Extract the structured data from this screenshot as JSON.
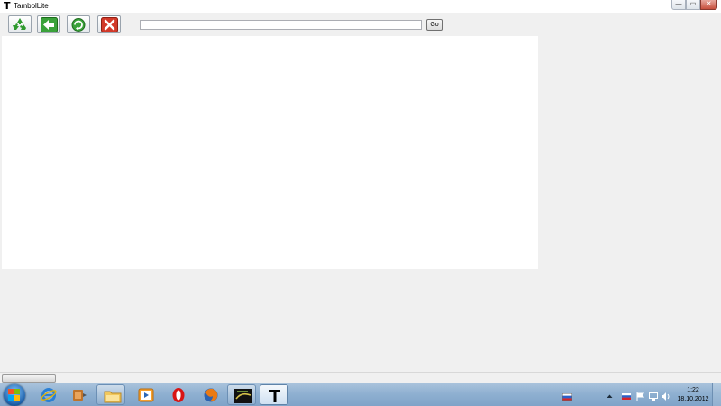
{
  "window": {
    "title": "TambolLite",
    "app_icon_glyph": "T",
    "controls": [
      {
        "name": "minimize",
        "glyph": "—"
      },
      {
        "name": "maximize",
        "glyph": "▭"
      },
      {
        "name": "close",
        "glyph": "✕"
      }
    ]
  },
  "toolbar": {
    "buttons": [
      {
        "name": "recycle-button",
        "icon": "recycle-icon"
      },
      {
        "name": "back-button",
        "icon": "arrow-left-icon"
      },
      {
        "name": "refresh-button",
        "icon": "refresh-icon"
      },
      {
        "name": "stop-button",
        "icon": "close-icon"
      }
    ],
    "address_value": "",
    "go_label": "Go"
  },
  "taskbar": {
    "items": [
      {
        "name": "internet-explorer",
        "icon": "internet-explorer-icon"
      },
      {
        "name": "media-center",
        "icon": "media-center-icon"
      },
      {
        "name": "explorer",
        "icon": "folder-icon"
      },
      {
        "name": "media-player",
        "icon": "media-player-icon"
      },
      {
        "name": "opera",
        "icon": "opera-icon"
      },
      {
        "name": "firefox",
        "icon": "firefox-icon"
      },
      {
        "name": "game",
        "icon": "game-icon"
      },
      {
        "name": "tambollite",
        "icon": "tambollite-icon",
        "glyph": "T"
      }
    ],
    "tray": {
      "language": "russian-flag-icon",
      "time": "1:22",
      "date": "18.10.2012"
    }
  },
  "colors": {
    "accent_green": "#2f9a2f",
    "stop_red": "#d23a2a",
    "taskbar": "#8fb0d1"
  }
}
